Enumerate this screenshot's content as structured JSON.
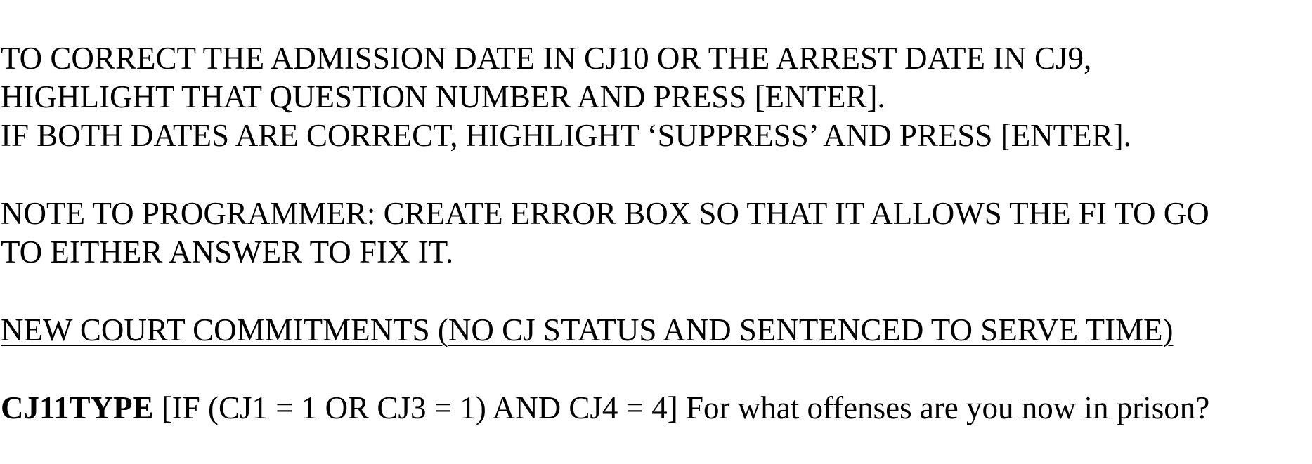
{
  "instructions": {
    "line1": "TO CORRECT THE ADMISSION DATE IN CJ10 OR THE ARREST DATE IN CJ9,",
    "line2": "HIGHLIGHT THAT QUESTION NUMBER AND PRESS [ENTER].",
    "line3": "IF BOTH DATES ARE CORRECT, HIGHLIGHT ‘SUPPRESS’ AND PRESS [ENTER]."
  },
  "programmer_note": {
    "line1": "NOTE TO PROGRAMMER: CREATE ERROR BOX SO THAT IT ALLOWS THE FI TO GO",
    "line2": "TO EITHER ANSWER TO FIX IT."
  },
  "section_heading": "NEW COURT COMMITMENTS (NO CJ STATUS AND SENTENCED TO SERVE TIME)",
  "question": {
    "id": "CJ11TYPE",
    "text": " [IF (CJ1 = 1 OR CJ3 = 1) AND CJ4 = 4] For what offenses are you now in prison?"
  }
}
